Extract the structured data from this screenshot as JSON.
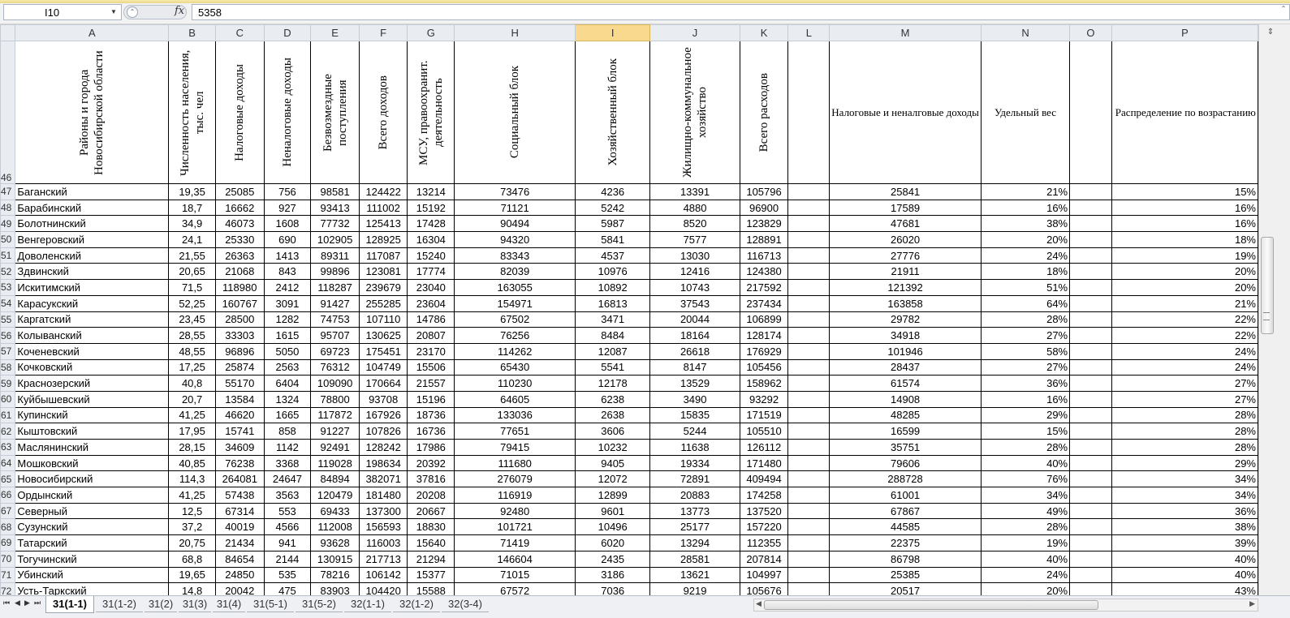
{
  "formula_bar": {
    "name_box": "I10",
    "fx_label": "fx",
    "formula_value": "5358"
  },
  "columns": [
    "A",
    "B",
    "C",
    "D",
    "E",
    "F",
    "G",
    "H",
    "I",
    "J",
    "K",
    "L",
    "M",
    "N",
    "O",
    "P"
  ],
  "selected_column": "I",
  "header_row": {
    "row_number": "46",
    "A": "Районы и города Новосибирской области",
    "B": "Численность населения, тыс. чел",
    "C": "Налоговые доходы",
    "D": "Неналоговые доходы",
    "E": "Безвозмездные поступления",
    "F": "Всего доходов",
    "G": "МСУ, правоохранит. деятельность",
    "H": "Социальный блок",
    "I": "Хозяйственный блок",
    "J": "Жилищно-коммунальное хозяйство",
    "K": "Всего расходов",
    "M": "Налоговые и неналговые доходы",
    "N": "Удельный вес",
    "P": "Распределение по возрастанию"
  },
  "rows": [
    {
      "num": "47",
      "A": "Баганский",
      "B": "19,35",
      "C": "25085",
      "D": "756",
      "E": "98581",
      "F": "124422",
      "G": "13214",
      "H": "73476",
      "I": "4236",
      "J": "13391",
      "K": "105796",
      "M": "25841",
      "N": "21%",
      "P": "15%"
    },
    {
      "num": "48",
      "A": "Барабинский",
      "B": "18,7",
      "C": "16662",
      "D": "927",
      "E": "93413",
      "F": "111002",
      "G": "15192",
      "H": "71121",
      "I": "5242",
      "J": "4880",
      "K": "96900",
      "M": "17589",
      "N": "16%",
      "P": "16%"
    },
    {
      "num": "49",
      "A": "Болотнинский",
      "B": "34,9",
      "C": "46073",
      "D": "1608",
      "E": "77732",
      "F": "125413",
      "G": "17428",
      "H": "90494",
      "I": "5987",
      "J": "8520",
      "K": "123829",
      "M": "47681",
      "N": "38%",
      "P": "16%"
    },
    {
      "num": "50",
      "A": "Венгеровский",
      "B": "24,1",
      "C": "25330",
      "D": "690",
      "E": "102905",
      "F": "128925",
      "G": "16304",
      "H": "94320",
      "I": "5841",
      "J": "7577",
      "K": "128891",
      "M": "26020",
      "N": "20%",
      "P": "18%"
    },
    {
      "num": "51",
      "A": "Доволенский",
      "B": "21,55",
      "C": "26363",
      "D": "1413",
      "E": "89311",
      "F": "117087",
      "G": "15240",
      "H": "83343",
      "I": "4537",
      "J": "13030",
      "K": "116713",
      "M": "27776",
      "N": "24%",
      "P": "19%"
    },
    {
      "num": "52",
      "A": "Здвинский",
      "B": "20,65",
      "C": "21068",
      "D": "843",
      "E": "99896",
      "F": "123081",
      "G": "17774",
      "H": "82039",
      "I": "10976",
      "J": "12416",
      "K": "124380",
      "M": "21911",
      "N": "18%",
      "P": "20%"
    },
    {
      "num": "53",
      "A": "Искитимский",
      "B": "71,5",
      "C": "118980",
      "D": "2412",
      "E": "118287",
      "F": "239679",
      "G": "23040",
      "H": "163055",
      "I": "10892",
      "J": "10743",
      "K": "217592",
      "M": "121392",
      "N": "51%",
      "P": "20%"
    },
    {
      "num": "54",
      "A": "Карасукский",
      "B": "52,25",
      "C": "160767",
      "D": "3091",
      "E": "91427",
      "F": "255285",
      "G": "23604",
      "H": "154971",
      "I": "16813",
      "J": "37543",
      "K": "237434",
      "M": "163858",
      "N": "64%",
      "P": "21%"
    },
    {
      "num": "55",
      "A": "Каргатский",
      "B": "23,45",
      "C": "28500",
      "D": "1282",
      "E": "74753",
      "F": "107110",
      "G": "14786",
      "H": "67502",
      "I": "3471",
      "J": "20044",
      "K": "106899",
      "M": "29782",
      "N": "28%",
      "P": "22%"
    },
    {
      "num": "56",
      "A": "Колыванский",
      "B": "28,55",
      "C": "33303",
      "D": "1615",
      "E": "95707",
      "F": "130625",
      "G": "20807",
      "H": "76256",
      "I": "8484",
      "J": "18164",
      "K": "128174",
      "M": "34918",
      "N": "27%",
      "P": "22%"
    },
    {
      "num": "57",
      "A": "Коченевский",
      "B": "48,55",
      "C": "96896",
      "D": "5050",
      "E": "69723",
      "F": "175451",
      "G": "23170",
      "H": "114262",
      "I": "12087",
      "J": "26618",
      "K": "176929",
      "M": "101946",
      "N": "58%",
      "P": "24%"
    },
    {
      "num": "58",
      "A": "Кочковский",
      "B": "17,25",
      "C": "25874",
      "D": "2563",
      "E": "76312",
      "F": "104749",
      "G": "15506",
      "H": "65430",
      "I": "5541",
      "J": "8147",
      "K": "105456",
      "M": "28437",
      "N": "27%",
      "P": "24%"
    },
    {
      "num": "59",
      "A": "Краснозерский",
      "B": "40,8",
      "C": "55170",
      "D": "6404",
      "E": "109090",
      "F": "170664",
      "G": "21557",
      "H": "110230",
      "I": "12178",
      "J": "13529",
      "K": "158962",
      "M": "61574",
      "N": "36%",
      "P": "27%"
    },
    {
      "num": "60",
      "A": "Куйбышевский",
      "B": "20,7",
      "C": "13584",
      "D": "1324",
      "E": "78800",
      "F": "93708",
      "G": "15196",
      "H": "64605",
      "I": "6238",
      "J": "3490",
      "K": "93292",
      "M": "14908",
      "N": "16%",
      "P": "27%"
    },
    {
      "num": "61",
      "A": "Купинский",
      "B": "41,25",
      "C": "46620",
      "D": "1665",
      "E": "117872",
      "F": "167926",
      "G": "18736",
      "H": "133036",
      "I": "2638",
      "J": "15835",
      "K": "171519",
      "M": "48285",
      "N": "29%",
      "P": "28%"
    },
    {
      "num": "62",
      "A": "Кыштовский",
      "B": "17,95",
      "C": "15741",
      "D": "858",
      "E": "91227",
      "F": "107826",
      "G": "16736",
      "H": "77651",
      "I": "3606",
      "J": "5244",
      "K": "105510",
      "M": "16599",
      "N": "15%",
      "P": "28%"
    },
    {
      "num": "63",
      "A": "Маслянинский",
      "B": "28,15",
      "C": "34609",
      "D": "1142",
      "E": "92491",
      "F": "128242",
      "G": "17986",
      "H": "79415",
      "I": "10232",
      "J": "11638",
      "K": "126112",
      "M": "35751",
      "N": "28%",
      "P": "28%"
    },
    {
      "num": "64",
      "A": "Мошковский",
      "B": "40,85",
      "C": "76238",
      "D": "3368",
      "E": "119028",
      "F": "198634",
      "G": "20392",
      "H": "111680",
      "I": "9405",
      "J": "19334",
      "K": "171480",
      "M": "79606",
      "N": "40%",
      "P": "29%"
    },
    {
      "num": "65",
      "A": "Новосибирский",
      "B": "114,3",
      "C": "264081",
      "D": "24647",
      "E": "84894",
      "F": "382071",
      "G": "37816",
      "H": "276079",
      "I": "12072",
      "J": "72891",
      "K": "409494",
      "M": "288728",
      "N": "76%",
      "P": "34%"
    },
    {
      "num": "66",
      "A": "Ордынский",
      "B": "41,25",
      "C": "57438",
      "D": "3563",
      "E": "120479",
      "F": "181480",
      "G": "20208",
      "H": "116919",
      "I": "12899",
      "J": "20883",
      "K": "174258",
      "M": "61001",
      "N": "34%",
      "P": "34%"
    },
    {
      "num": "67",
      "A": "Северный",
      "B": "12,5",
      "C": "67314",
      "D": "553",
      "E": "69433",
      "F": "137300",
      "G": "20667",
      "H": "92480",
      "I": "9601",
      "J": "13773",
      "K": "137520",
      "M": "67867",
      "N": "49%",
      "P": "36%"
    },
    {
      "num": "68",
      "A": "Сузунский",
      "B": "37,2",
      "C": "40019",
      "D": "4566",
      "E": "112008",
      "F": "156593",
      "G": "18830",
      "H": "101721",
      "I": "10496",
      "J": "25177",
      "K": "157220",
      "M": "44585",
      "N": "28%",
      "P": "38%"
    },
    {
      "num": "69",
      "A": "Татарский",
      "B": "20,75",
      "C": "21434",
      "D": "941",
      "E": "93628",
      "F": "116003",
      "G": "15640",
      "H": "71419",
      "I": "6020",
      "J": "13294",
      "K": "112355",
      "M": "22375",
      "N": "19%",
      "P": "39%"
    },
    {
      "num": "70",
      "A": "Тогучинский",
      "B": "68,8",
      "C": "84654",
      "D": "2144",
      "E": "130915",
      "F": "217713",
      "G": "21294",
      "H": "146604",
      "I": "2435",
      "J": "28581",
      "K": "207814",
      "M": "86798",
      "N": "40%",
      "P": "40%"
    },
    {
      "num": "71",
      "A": "Убинский",
      "B": "19,65",
      "C": "24850",
      "D": "535",
      "E": "78216",
      "F": "106142",
      "G": "15377",
      "H": "71015",
      "I": "3186",
      "J": "13621",
      "K": "104997",
      "M": "25385",
      "N": "24%",
      "P": "40%"
    },
    {
      "num": "72",
      "A": "Усть-Таркский",
      "B": "14,8",
      "C": "20042",
      "D": "475",
      "E": "83903",
      "F": "104420",
      "G": "15588",
      "H": "67572",
      "I": "7036",
      "J": "9219",
      "K": "105676",
      "M": "20517",
      "N": "20%",
      "P": "43%"
    }
  ],
  "sheet_tabs": [
    "31(1-1)",
    "31(1-2)",
    "31(2)",
    "31(3)",
    "31(4)",
    "31(5-1)",
    "31(5-2)",
    "32(1-1)",
    "32(1-2)",
    "32(3-4)"
  ],
  "active_tab": "31(1-1)",
  "nav_arrows": [
    "⏮",
    "◀",
    "▶",
    "⏭"
  ],
  "colors": {
    "selected_header": "#f9d98e",
    "header_bg": "#e9edf2"
  }
}
